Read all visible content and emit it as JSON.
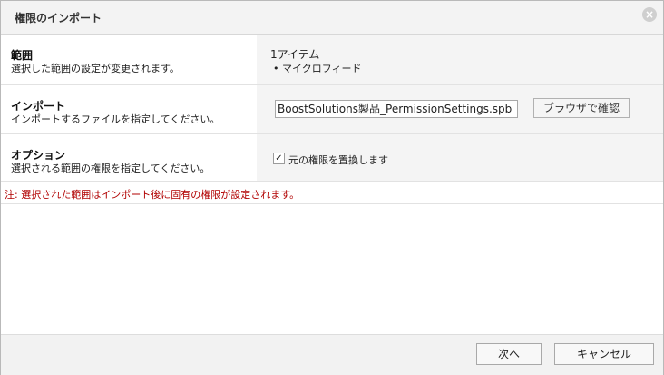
{
  "dialog": {
    "title": "権限のインポート",
    "close_icon": "close-icon"
  },
  "scope": {
    "heading": "範囲",
    "description": "選択した範囲の設定が変更されます。",
    "count": "1アイテム",
    "item": "• マイクロフィード"
  },
  "import": {
    "heading": "インポート",
    "description": "インポートするファイルを指定してください。",
    "file_value": "BoostSolutions製品_PermissionSettings.spb",
    "browse_label": "ブラウザで確認"
  },
  "options": {
    "heading": "オプション",
    "description": "選択される範囲の権限を指定してください。",
    "checkbox_checked": true,
    "checkbox_label": "元の権限を置換します"
  },
  "note": "注: 選択された範囲はインポート後に固有の権限が設定されます。",
  "footer": {
    "next_label": "次へ",
    "cancel_label": "キャンセル"
  }
}
